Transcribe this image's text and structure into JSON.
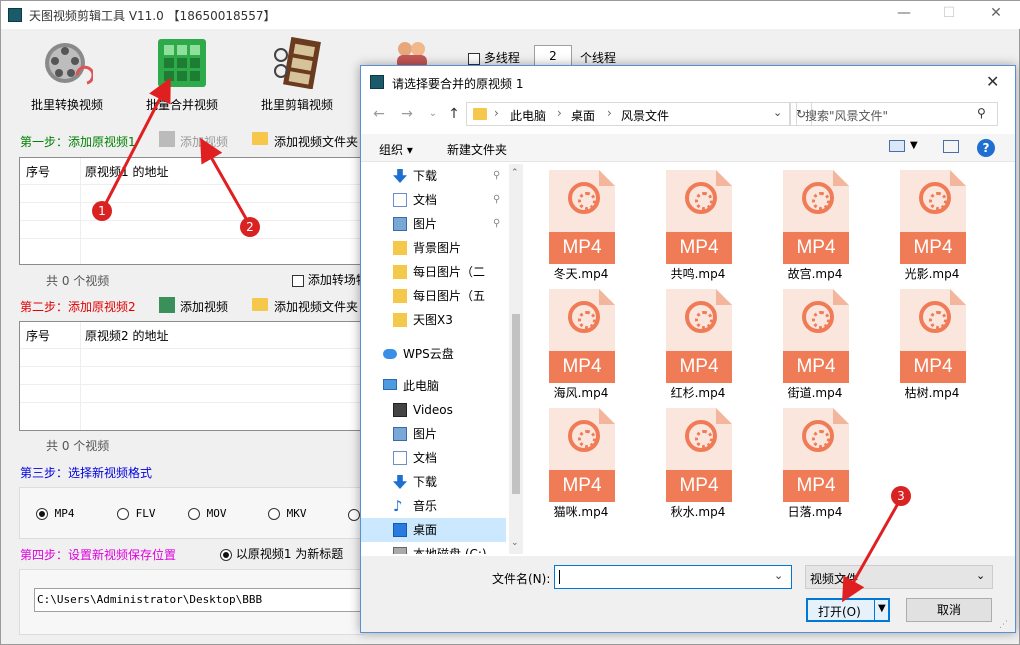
{
  "main": {
    "title": "天图视频剪辑工具 V11.0 【18650018557】",
    "toolbar": {
      "convert_label": "批里转换视频",
      "merge_label": "批量合并视频",
      "edit_label": "批里剪辑视频",
      "multithread_label": "多线程",
      "thread_count": "2",
      "thread_unit": "个线程"
    },
    "step1": {
      "label": "第一步：添加原视频1",
      "add_video": "添加视频",
      "add_folder": "添加视频文件夹",
      "col_index": "序号",
      "col_path": "原视频1 的地址",
      "count": "共 0 个视频",
      "transition_label": "添加转场特"
    },
    "step2": {
      "label": "第二步：添加原视频2",
      "add_video": "添加视频",
      "add_folder": "添加视频文件夹",
      "col_index": "序号",
      "col_path": "原视频2 的地址",
      "count": "共 0 个视频"
    },
    "step3": {
      "label": "第三步：选择新视频格式",
      "formats": [
        "MP4",
        "FLV",
        "MOV",
        "MKV"
      ]
    },
    "step4": {
      "label": "第四步：设置新视频保存位置",
      "title_option": "以原视频1 为新标题",
      "path": "C:\\Users\\Administrator\\Desktop\\BBB"
    }
  },
  "dialog": {
    "title": "请选择要合并的原视频 1",
    "breadcrumb": [
      "此电脑",
      "桌面",
      "风景文件"
    ],
    "search_placeholder": "搜索\"风景文件\"",
    "organize_label": "组织 ▾",
    "new_folder_label": "新建文件夹",
    "tree": [
      {
        "label": "下载",
        "icon": "download-icon",
        "pinned": true
      },
      {
        "label": "文档",
        "icon": "document-icon",
        "pinned": true
      },
      {
        "label": "图片",
        "icon": "picture-icon",
        "pinned": true
      },
      {
        "label": "背景图片",
        "icon": "folder-icon",
        "pinned": false
      },
      {
        "label": "每日图片（二",
        "icon": "folder-icon",
        "pinned": false
      },
      {
        "label": "每日图片（五",
        "icon": "folder-icon",
        "pinned": false
      },
      {
        "label": "天图X3",
        "icon": "folder-icon",
        "pinned": false
      },
      {
        "label": "WPS云盘",
        "icon": "cloud-icon",
        "pinned": false
      },
      {
        "label": "此电脑",
        "icon": "computer-icon",
        "pinned": false
      },
      {
        "label": "Videos",
        "icon": "video-icon",
        "pinned": false
      },
      {
        "label": "图片",
        "icon": "picture-icon",
        "pinned": false
      },
      {
        "label": "文档",
        "icon": "document-icon",
        "pinned": false
      },
      {
        "label": "下载",
        "icon": "download-icon",
        "pinned": false
      },
      {
        "label": "音乐",
        "icon": "music-icon",
        "pinned": false
      },
      {
        "label": "桌面",
        "icon": "desktop-icon",
        "pinned": false,
        "selected": true
      },
      {
        "label": "本地磁盘 (C:)",
        "icon": "disk-icon",
        "pinned": false
      }
    ],
    "files": [
      "冬天.mp4",
      "共鸣.mp4",
      "故宫.mp4",
      "光影.mp4",
      "海风.mp4",
      "红杉.mp4",
      "街道.mp4",
      "枯树.mp4",
      "猫咪.mp4",
      "秋水.mp4",
      "日落.mp4"
    ],
    "file_badge": "MP4",
    "filename_label": "文件名(N):",
    "filename_value": "",
    "filetype_value": "视频文件",
    "open_label": "打开(O)",
    "cancel_label": "取消"
  },
  "annotations": [
    "1",
    "2",
    "3"
  ],
  "colors": {
    "accent": "#0078d7",
    "marker": "#d92323",
    "file_band": "#f07b57"
  }
}
